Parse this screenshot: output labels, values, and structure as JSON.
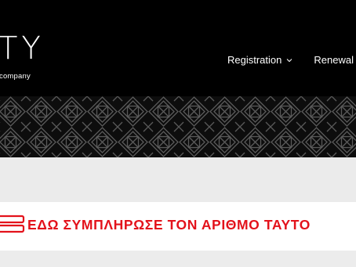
{
  "header": {
    "logo_text": "TY",
    "logo_tagline": "company",
    "nav": [
      {
        "label": "Registration",
        "has_dropdown": true
      },
      {
        "label": "Renewal",
        "has_dropdown": false
      }
    ]
  },
  "notice": {
    "text": "ΕΔΩ ΣΥΜΠΛΗΡΩΣΕ ΤΟΝ ΑΡΙΘΜΟ ΤΑΥΤΟ",
    "color": "#e3121b"
  },
  "colors": {
    "header_bg": "#000000",
    "pattern_stroke": "#555555",
    "gap_bg": "#ebebeb"
  }
}
